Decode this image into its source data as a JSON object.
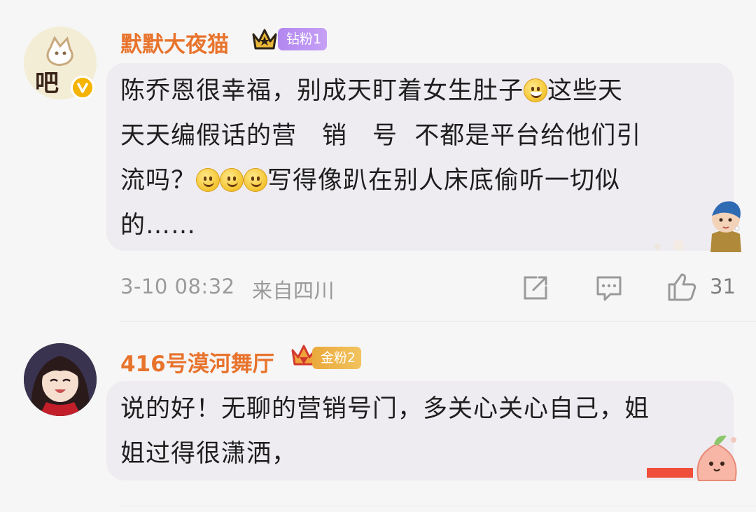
{
  "comments": [
    {
      "username": "默默大夜猫",
      "badge": "钻粉1",
      "lines": [
        "陈乔恩很幸福，别成天盯着女生肚子",
        "天天编假话的营　销　号  不都是平台给他们引",
        "流吗？",
        "的……"
      ],
      "line1_after_emoji": "这些天",
      "line3_after_emoji": "写得像趴在别人床底偷听一切似",
      "time": "3-10 08:32",
      "location": "来自四川",
      "like_count": "31"
    },
    {
      "username": "416号漠河舞厅",
      "badge": "金粉2",
      "lines": [
        "说的好！无聊的营销号门，多关心关心自己，姐",
        "姐过得很潇洒，"
      ]
    }
  ],
  "colors": {
    "username": "#e8732c",
    "badge_diamond": "#b287f0",
    "badge_gold": "#eaa93c",
    "bubble": "#efecf1",
    "meta": "#9a9a9a"
  },
  "icons": [
    "crown-icon",
    "verified-icon",
    "share-icon",
    "comment-icon",
    "like-icon"
  ]
}
